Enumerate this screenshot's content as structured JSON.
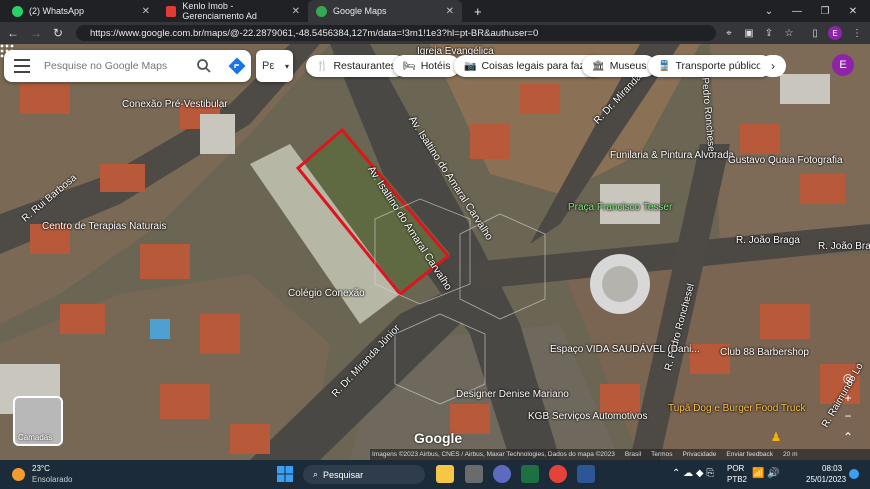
{
  "browser": {
    "tabs": [
      {
        "label": "(2) WhatsApp",
        "icon": "whatsapp-icon",
        "color": "#25d366"
      },
      {
        "label": "Kenlo Imob - Gerenciamento Ad",
        "icon": "kenlo-icon",
        "color": "#e53935"
      },
      {
        "label": "Google Maps",
        "icon": "maps-icon",
        "color": "#34a853"
      }
    ],
    "new_tab": "+",
    "url": "https://www.google.com.br/maps/@-22.2879061,-48.5456384,127m/data=!3m1!1e3?hl=pt-BR&authuser=0",
    "profile_initial": "E"
  },
  "maps": {
    "search_placeholder": "Pesquise no Google Maps",
    "second_input": "Pε",
    "chips": [
      {
        "label": "Restaurantes",
        "icon": "restaurant-icon"
      },
      {
        "label": "Hotéis",
        "icon": "hotel-icon"
      },
      {
        "label": "Coisas legais para faz...",
        "icon": "camera-icon"
      },
      {
        "label": "Museus",
        "icon": "museum-icon"
      },
      {
        "label": "Transporte público",
        "icon": "transit-icon"
      }
    ],
    "account_initial": "E",
    "layers_label": "Camadas",
    "google_logo": "Google",
    "attribution": [
      "Imagens ©2023 Airbus, CNES / Airbus, Maxar Technologies, Dados do mapa ©2023",
      "Brasil",
      "Termos",
      "Privacidade",
      "Enviar feedback",
      "20 m"
    ],
    "labels": {
      "streets": [
        "Av. Isaltino do Amaral Carvalho",
        "Av. Isaltino do Amaral Carvalho",
        "R. Dr. Miranda Júnior",
        "R. Dr. Miranda",
        "R. Rui Barbosa",
        "R. João Braga",
        "R. João Brag",
        "R. Pedro Ronchesel",
        "Pedro Ronchesel",
        "R. Raimundo Lo"
      ],
      "places": [
        "Conexão Pré-Vestibular",
        "Centro de Terapias Naturais",
        "Colégio Conexão",
        "Funilaria & Pintura Alvorada",
        "Gustavo Quaia Fotografia",
        "Praça Francisco Tesser",
        "Espaço VIDA SAUDÁVEL (Dani...",
        "Designer Denise Mariano",
        "KGB Serviços Automotivos",
        "Club 88 Barbershop",
        "Tupã Dog e Burger Food Truck",
        "Igreja Evangélica"
      ]
    }
  },
  "taskbar": {
    "weather_temp": "23°C",
    "weather_desc": "Ensolarado",
    "search_label": "Pesquisar",
    "lang": "POR",
    "lang2": "PTB2",
    "time": "08:03",
    "date": "25/01/2023"
  }
}
